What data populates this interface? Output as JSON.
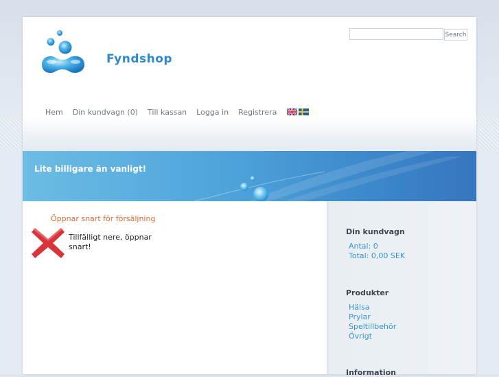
{
  "brand": {
    "name": "Fyndshop"
  },
  "search": {
    "placeholder": "",
    "button_label": "Search"
  },
  "nav": {
    "items": [
      {
        "label": "Hem"
      },
      {
        "label": "Din kundvagn (0)"
      },
      {
        "label": "Till kassan"
      },
      {
        "label": "Logga in"
      },
      {
        "label": "Registrera"
      }
    ],
    "flags": [
      "uk-flag-icon",
      "swedish-flag-icon"
    ]
  },
  "banner": {
    "title": "Lite billigare än vanligt!"
  },
  "notice": {
    "title": "Öppnar snart för försäljning",
    "text": "Tillfälligt nere, öppnar snart!",
    "icon": "x-icon"
  },
  "sidebar": {
    "cart": {
      "heading": "Din kundvagn",
      "count_line": "Antal: 0",
      "total_line": "Total: 0,00 SEK"
    },
    "products": {
      "heading": "Produkter",
      "items": [
        {
          "label": "Hälsa"
        },
        {
          "label": "Prylar"
        },
        {
          "label": "Speltillbehör"
        },
        {
          "label": "Övrigt"
        }
      ]
    },
    "information": {
      "heading": "Information"
    }
  },
  "colors": {
    "brand_blue": "#2e8bc9",
    "banner_start": "#6cbce4",
    "banner_end": "#3676bf",
    "notice_orange": "#d86b35",
    "link_blue": "#3b94cf",
    "error_red": "#d8343a"
  }
}
